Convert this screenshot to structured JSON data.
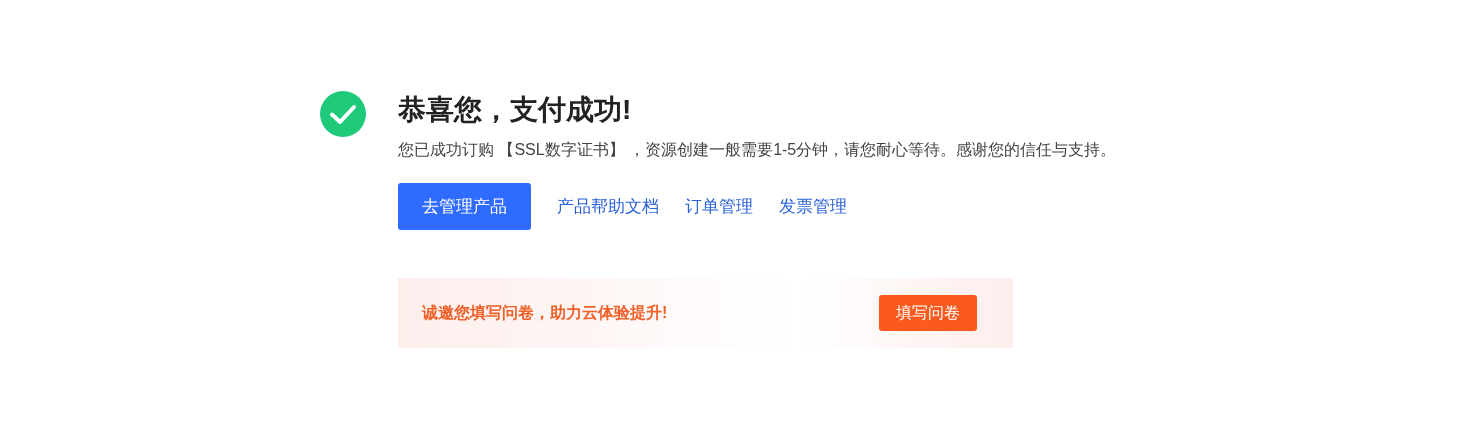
{
  "result": {
    "title": "恭喜您，支付成功!",
    "message": "您已成功订购 【SSL数字证书】 ，资源创建一般需要1-5分钟，请您耐心等待。感谢您的信任与支持。"
  },
  "actions": [
    {
      "kind": "primary",
      "label": "去管理产品"
    },
    {
      "kind": "link",
      "label": "产品帮助文档"
    },
    {
      "kind": "link",
      "label": "订单管理"
    },
    {
      "kind": "link",
      "label": "发票管理"
    }
  ],
  "survey": {
    "text": "诚邀您填写问卷，助力云体验提升!",
    "button": "填写问卷"
  }
}
